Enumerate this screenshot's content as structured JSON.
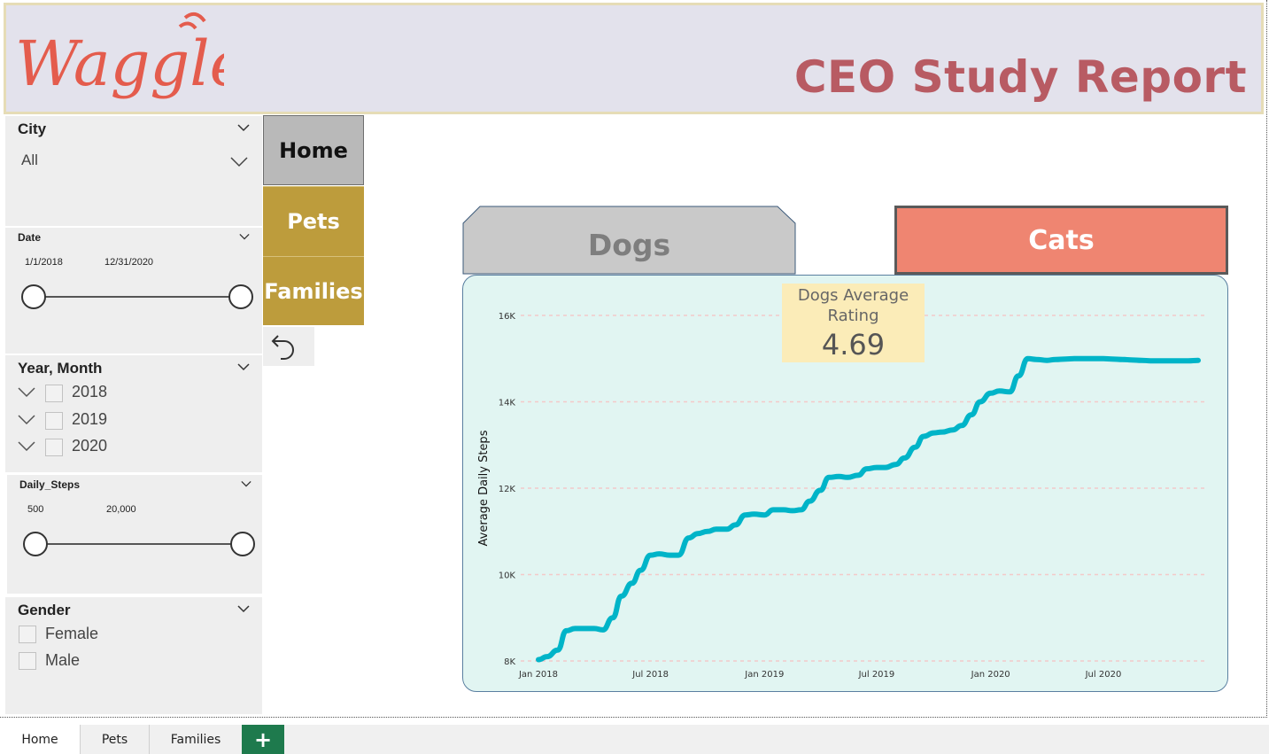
{
  "header": {
    "logo_text": "Waggle",
    "title": "CEO Study Report"
  },
  "slicers": {
    "city": {
      "title": "City",
      "value": "All"
    },
    "date": {
      "title": "Date",
      "start": "1/1/2018",
      "end": "12/31/2020"
    },
    "year_month": {
      "title": "Year, Month",
      "items": [
        "2018",
        "2019",
        "2020"
      ]
    },
    "daily_steps": {
      "title": "Daily_Steps",
      "min": "500",
      "max": "20,000"
    },
    "gender": {
      "title": "Gender",
      "items": [
        "Female",
        "Male"
      ]
    }
  },
  "nav": {
    "home": "Home",
    "pets": "Pets",
    "families": "Families",
    "back_icon": "undo-arrow-icon"
  },
  "tabs": {
    "dogs": "Dogs",
    "cats": "Cats"
  },
  "kpi": {
    "label": "Dogs Average Rating",
    "value": "4.69"
  },
  "colors": {
    "line": "#00b4c8",
    "cats_tab": "#ef8571",
    "nav_gold": "#bd9c3c",
    "title": "#b85b63",
    "logo": "#e45c4d"
  },
  "chart_data": {
    "type": "line",
    "ylabel": "Average Daily Steps",
    "xlabel": "",
    "x_ticks": [
      "Jan 2018",
      "Jul 2018",
      "Jan 2019",
      "Jul 2019",
      "Jan 2020",
      "Jul 2020"
    ],
    "y_ticks": [
      "8K",
      "10K",
      "12K",
      "14K",
      "16K"
    ],
    "ylim": [
      8000,
      16000
    ],
    "grid": true,
    "series": [
      {
        "x": [
          "2018-01-01",
          "2018-01-15",
          "2018-02-01",
          "2018-02-15",
          "2018-03-01",
          "2018-03-15",
          "2018-04-01",
          "2018-04-15",
          "2018-05-01",
          "2018-05-15",
          "2018-06-01",
          "2018-06-15",
          "2018-07-01",
          "2018-07-15",
          "2018-08-01",
          "2018-08-15",
          "2018-09-01",
          "2018-09-15",
          "2018-10-01",
          "2018-10-15",
          "2018-11-01",
          "2018-11-15",
          "2018-12-01",
          "2018-12-15",
          "2019-01-01",
          "2019-01-15",
          "2019-02-01",
          "2019-02-15",
          "2019-03-01",
          "2019-03-15",
          "2019-04-01",
          "2019-04-15",
          "2019-05-01",
          "2019-05-15",
          "2019-06-01",
          "2019-06-15",
          "2019-07-01",
          "2019-07-15",
          "2019-08-01",
          "2019-08-15",
          "2019-09-01",
          "2019-09-15",
          "2019-10-01",
          "2019-10-15",
          "2019-11-01",
          "2019-11-15",
          "2019-12-01",
          "2019-12-15",
          "2020-01-01",
          "2020-01-15",
          "2020-02-01",
          "2020-02-15",
          "2020-03-01",
          "2020-03-15",
          "2020-04-01",
          "2020-04-15",
          "2020-05-01",
          "2020-05-15",
          "2020-06-01",
          "2020-06-15",
          "2020-07-01",
          "2020-07-15",
          "2020-08-01",
          "2020-08-15",
          "2020-09-01",
          "2020-09-15",
          "2020-10-01",
          "2020-10-15",
          "2020-11-01",
          "2020-11-15",
          "2020-12-01"
        ],
        "values": [
          8030,
          8100,
          8250,
          8700,
          8750,
          8750,
          8750,
          8720,
          9000,
          9500,
          9800,
          10100,
          10450,
          10480,
          10450,
          10450,
          10850,
          10950,
          11000,
          11050,
          11050,
          11150,
          11380,
          11400,
          11380,
          11500,
          11500,
          11480,
          11500,
          11700,
          11950,
          12250,
          12270,
          12250,
          12300,
          12450,
          12480,
          12480,
          12550,
          12700,
          12950,
          13200,
          13280,
          13300,
          13350,
          13450,
          13700,
          14000,
          14200,
          14250,
          14230,
          14600,
          15000,
          14980,
          14960,
          14980,
          14990,
          15000,
          15000,
          15000,
          15000,
          14990,
          14980,
          14970,
          14960,
          14950,
          14950,
          14950,
          14950,
          14950,
          14960
        ]
      }
    ]
  }
}
